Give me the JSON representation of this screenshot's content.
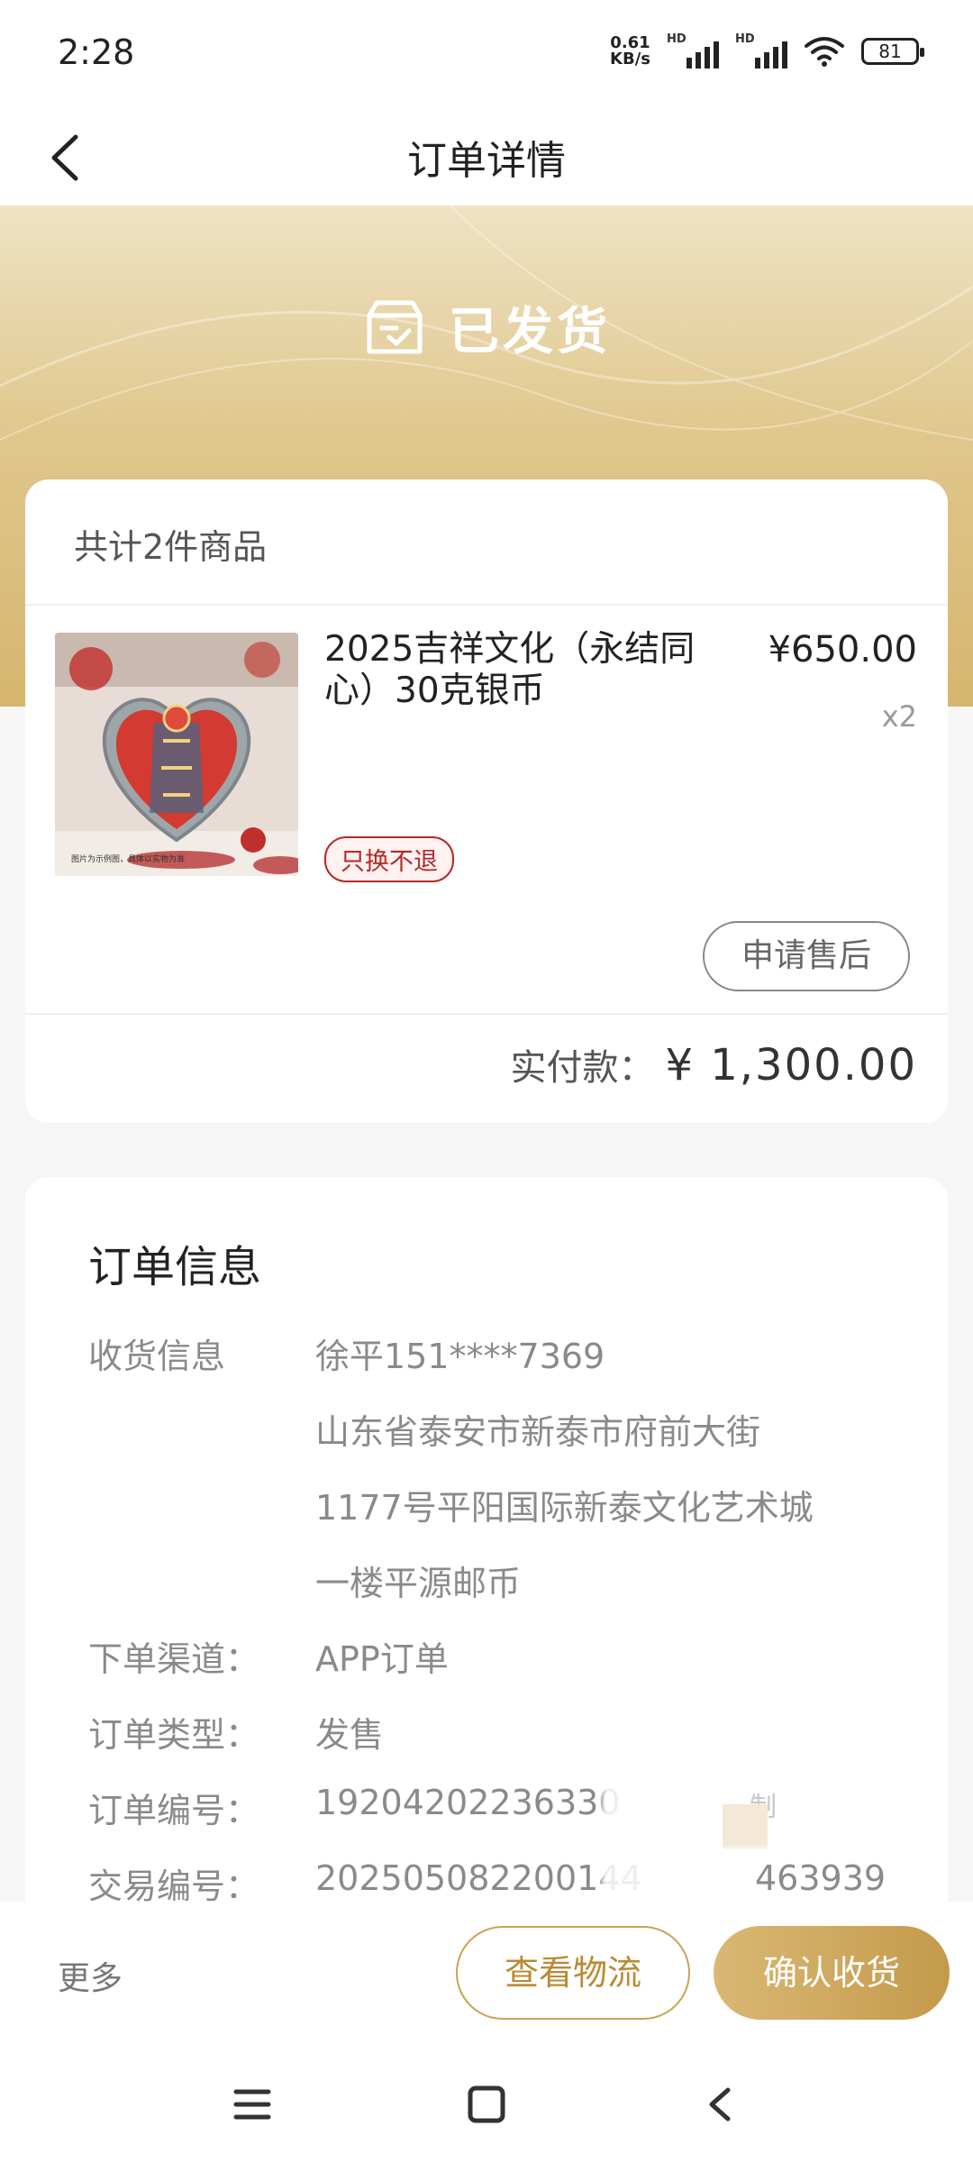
{
  "status_bar": {
    "time": "2:28",
    "net_speed_value": "0.61",
    "net_speed_unit": "KB/s",
    "hd1": "HD",
    "hd2": "HD",
    "battery": "81"
  },
  "header": {
    "title": "订单详情"
  },
  "order_status": {
    "text": "已发货",
    "icon": "package-check-icon"
  },
  "goods": {
    "count_label": "共计2件商品",
    "item": {
      "name": "2025吉祥文化（永结同心）30克银币",
      "price": "¥650.00",
      "qty": "x2",
      "tag": "只换不退",
      "image_caption": "图片为示例图，具体以实物为准"
    },
    "after_sale_button": "申请售后",
    "paid_label": "实付款：",
    "paid_amount": "¥ 1,300.00"
  },
  "order_info": {
    "title": "订单信息",
    "receiver_label": "收货信息",
    "receiver_line1": "徐平151****7369",
    "receiver_line2": "山东省泰安市新泰市府前大街",
    "receiver_line3": "1177号平阳国际新泰文化艺术城",
    "receiver_line4": "一楼平源邮币",
    "channel_label": "下单渠道：",
    "channel_value": "APP订单",
    "type_label": "订单类型：",
    "type_value": "发售",
    "order_no_label": "订单编号：",
    "order_no_value": "19204202236330",
    "copy_label": "制",
    "trade_no_label": "交易编号：",
    "trade_no_value": "202505082200144",
    "trade_no_tail": "463939"
  },
  "bottom_bar": {
    "more": "更多",
    "logistics_button": "查看物流",
    "confirm_button": "确认收货"
  },
  "colors": {
    "accent_gold": "#c49a4b",
    "tag_red": "#b22a2a"
  }
}
